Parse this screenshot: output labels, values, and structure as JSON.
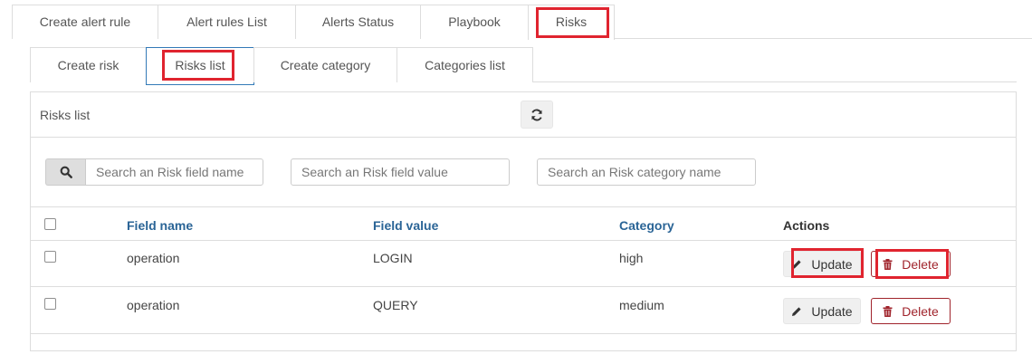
{
  "main_tabs": [
    {
      "label": "Create alert rule"
    },
    {
      "label": "Alert rules List"
    },
    {
      "label": "Alerts Status"
    },
    {
      "label": "Playbook"
    },
    {
      "label": "Risks"
    }
  ],
  "sub_tabs": [
    {
      "label": "Create risk"
    },
    {
      "label": "Risks list"
    },
    {
      "label": "Create category"
    },
    {
      "label": "Categories list"
    }
  ],
  "panel": {
    "title": "Risks list"
  },
  "filters": {
    "field_name_placeholder": "Search an Risk field name",
    "field_value_placeholder": "Search an Risk field value",
    "category_placeholder": "Search an Risk category name"
  },
  "table": {
    "headers": {
      "field_name": "Field name",
      "field_value": "Field value",
      "category": "Category",
      "actions": "Actions"
    },
    "rows": [
      {
        "field_name": "operation",
        "field_value": "LOGIN",
        "category": "high"
      },
      {
        "field_name": "operation",
        "field_value": "QUERY",
        "category": "medium"
      }
    ],
    "update_label": "Update",
    "delete_label": "Delete"
  },
  "colors": {
    "highlight": "#e0242f",
    "header_link": "#2a6496",
    "delete": "#a0242c"
  },
  "icons": {
    "refresh": "refresh-icon",
    "search": "search-icon",
    "update": "pencil-icon",
    "delete": "trash-icon"
  }
}
